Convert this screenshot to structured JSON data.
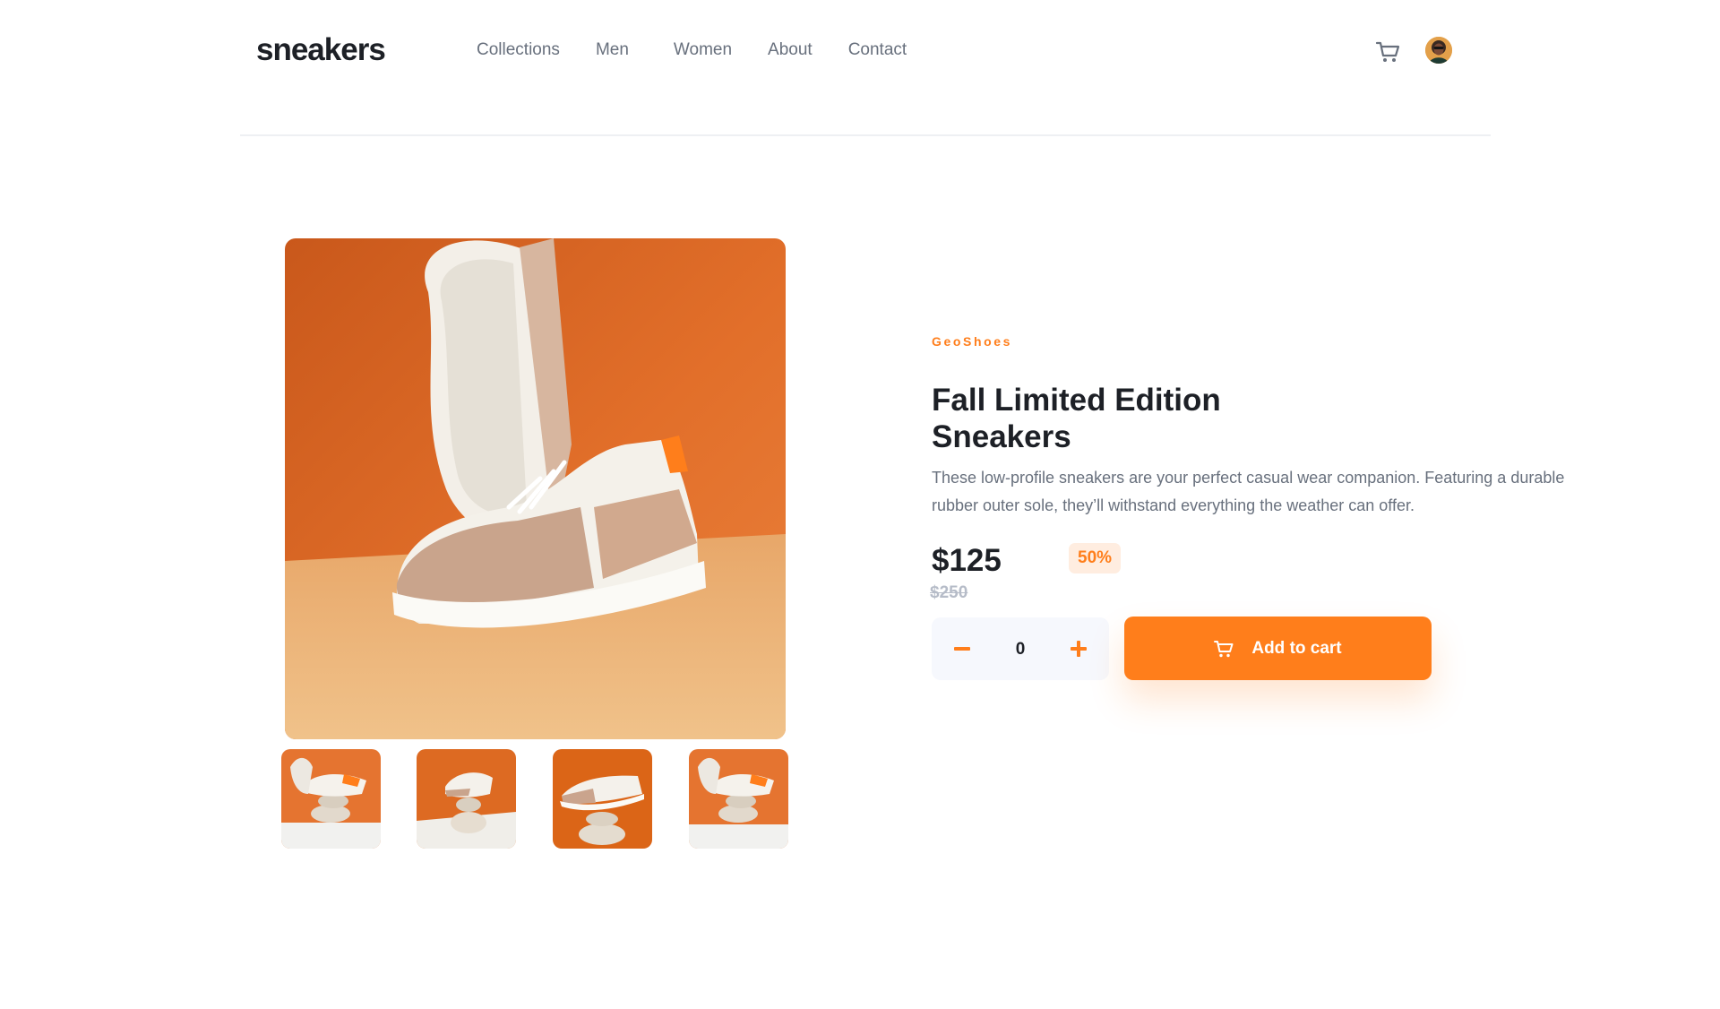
{
  "header": {
    "logo": "sneakers",
    "nav": [
      "Collections",
      "Men",
      "Women",
      "About",
      "Contact"
    ],
    "cart_icon": "cart-icon",
    "avatar_icon": "user-avatar"
  },
  "gallery": {
    "main_image": "product-image-1",
    "thumbnails": [
      "thumbnail-1",
      "thumbnail-2",
      "thumbnail-3",
      "thumbnail-4"
    ]
  },
  "product": {
    "brand": "GeoShoes",
    "title_line1": "Fall Limited Edition",
    "title_line2": "Sneakers",
    "description": "These low-profile sneakers are your perfect casual wear companion. Featuring a durable rubber outer sole, they’ll withstand everything the weather can offer.",
    "price": "$125",
    "discount": "50%",
    "old_price": "$250"
  },
  "cart": {
    "quantity": "0",
    "minus_icon": "minus-icon",
    "plus_icon": "plus-icon",
    "add_label": "Add to cart",
    "add_icon": "cart-icon"
  },
  "colors": {
    "accent": "#ff7e1b",
    "accent_pale": "#ffede0",
    "text_dark": "#1d2026",
    "text_gray": "#68707d",
    "strike_gray": "#b6bcc8",
    "qty_bg": "#f6f8fd"
  }
}
